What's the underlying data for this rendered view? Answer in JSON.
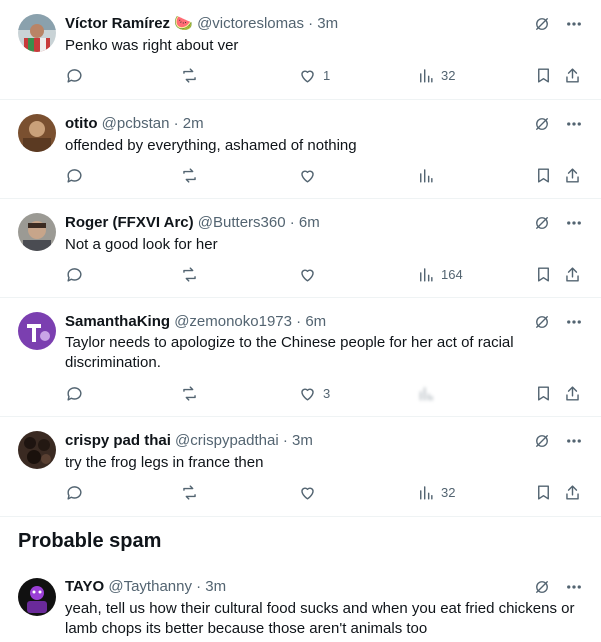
{
  "tweets": [
    {
      "name": "Víctor Ramírez 🍉",
      "handle": "@victoreslomas · 3m",
      "text": "Penko was right about ver",
      "replies": "",
      "retweets": "",
      "likes": "1",
      "views": "32"
    },
    {
      "name": "otito",
      "handle": "@pcbstan · 2m",
      "text": "offended by everything, ashamed of nothing",
      "replies": "",
      "retweets": "",
      "likes": "",
      "views": ""
    },
    {
      "name": "Roger (FFXVI Arc)",
      "handle": "@Butters360 · 6m",
      "text": "Not a good look for her",
      "replies": "",
      "retweets": "",
      "likes": "",
      "views": "164"
    },
    {
      "name": "SamanthaKing",
      "handle": "@zemonoko1973 · 6m",
      "text": "Taylor needs to apologize to the Chinese people for her act of racial discrimination.",
      "replies": "",
      "retweets": "",
      "likes": "3",
      "views": ""
    },
    {
      "name": "crispy pad thai",
      "handle": "@crispypadthai · 3m",
      "text": "try the frog legs in france then",
      "replies": "",
      "retweets": "",
      "likes": "",
      "views": "32"
    }
  ],
  "spam_section": {
    "title": "Probable spam"
  },
  "spam_tweet": {
    "name": "TAYO",
    "handle": "@Taythanny · 3m",
    "text": "yeah, tell us how their cultural food sucks and when you eat fried chickens or lamb chops its better because those aren't animals too"
  },
  "icons": {
    "grok": "grok-icon",
    "more": "more-icon",
    "reply": "reply-icon",
    "retweet": "retweet-icon",
    "like": "like-icon",
    "views": "views-icon",
    "bookmark": "bookmark-icon",
    "share": "share-icon"
  },
  "colors": {
    "text": "#0f1419",
    "muted": "#536471",
    "divider": "#eff3f4"
  }
}
